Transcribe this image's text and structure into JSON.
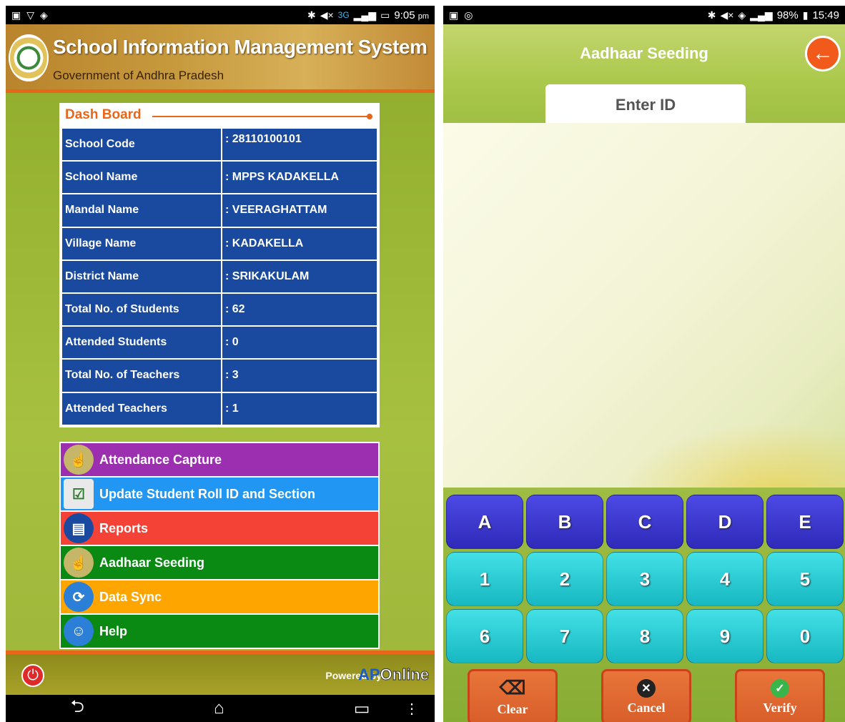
{
  "left_screen": {
    "status": {
      "network": "3G",
      "time": "9:05",
      "ampm": "pm"
    },
    "header": {
      "title": "School Information Management System",
      "subtitle": "Government of Andhra Pradesh"
    },
    "dashboard": {
      "title": "Dash Board",
      "rows": [
        {
          "label": "School Code",
          "value": ": 28110100101"
        },
        {
          "label": "School Name",
          "value": ": MPPS KADAKELLA"
        },
        {
          "label": "Mandal Name",
          "value": ": VEERAGHATTAM"
        },
        {
          "label": "Village Name",
          "value": ": KADAKELLA"
        },
        {
          "label": "District Name",
          "value": ": SRIKAKULAM"
        },
        {
          "label": "Total No. of Students",
          "value": ": 62"
        },
        {
          "label": "Attended Students",
          "value": ": 0"
        },
        {
          "label": "Total No. of Teachers",
          "value": ": 3"
        },
        {
          "label": "Attended Teachers",
          "value": ": 1"
        }
      ]
    },
    "menu": [
      {
        "label": "Attendance Capture",
        "color": "#9b2fb0",
        "icon_color": "#c5b66a"
      },
      {
        "label": "Update Student Roll ID and Section",
        "color": "#2196f3",
        "icon_color": "#e9e9e9"
      },
      {
        "label": "Reports",
        "color": "#f44336",
        "icon_color": "#1a4aa0"
      },
      {
        "label": "Aadhaar Seeding",
        "color": "#0a8a12",
        "icon_color": "#c5b66a"
      },
      {
        "label": "Data Sync",
        "color": "#ffa500",
        "icon_color": "#2b7fd6"
      },
      {
        "label": "Help",
        "color": "#0a8a12",
        "icon_color": "#2b7fd6"
      }
    ],
    "footer": {
      "powered_by": "Powered by",
      "brand_ap": "AP",
      "brand_online": "Online"
    }
  },
  "right_screen": {
    "status": {
      "battery": "98%",
      "time": "15:49"
    },
    "title": "Aadhaar Seeding",
    "input_placeholder": "Enter ID",
    "keypad": {
      "letters": [
        "A",
        "B",
        "C",
        "D",
        "E"
      ],
      "row1": [
        "1",
        "2",
        "3",
        "4",
        "5"
      ],
      "row2": [
        "6",
        "7",
        "8",
        "9",
        "0"
      ]
    },
    "actions": {
      "clear": "Clear",
      "cancel": "Cancel",
      "verify": "Verify"
    }
  }
}
